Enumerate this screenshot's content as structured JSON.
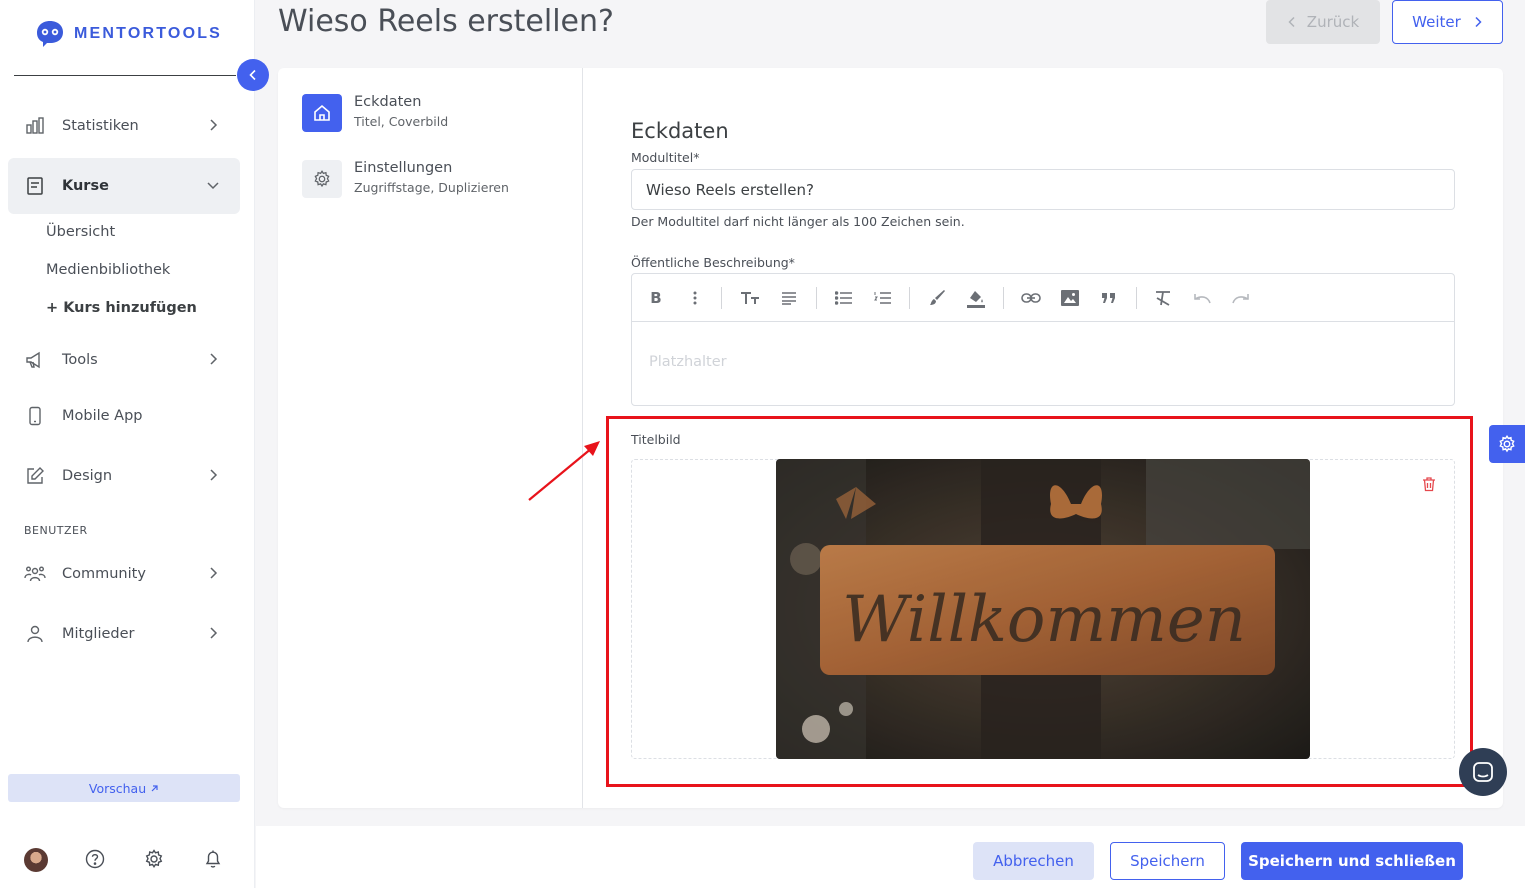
{
  "brand": {
    "name": "MENTORTOOLS"
  },
  "sidebar": {
    "items": [
      {
        "label": "Statistiken",
        "icon": "bar-chart-icon"
      },
      {
        "label": "Kurse",
        "icon": "book-icon"
      },
      {
        "label": "Tools",
        "icon": "megaphone-icon"
      },
      {
        "label": "Mobile App",
        "icon": "smartphone-icon"
      },
      {
        "label": "Design",
        "icon": "edit-icon"
      },
      {
        "label": "Community",
        "icon": "users-icon"
      },
      {
        "label": "Mitglieder",
        "icon": "user-icon"
      }
    ],
    "sub_items": [
      "Übersicht",
      "Medienbibliothek",
      "+ Kurs hinzufügen"
    ],
    "section_label": "BENUTZER",
    "preview_label": "Vorschau"
  },
  "header": {
    "title": "Wieso Reels erstellen?",
    "back_label": "Zurück",
    "next_label": "Weiter"
  },
  "steps": [
    {
      "title": "Eckdaten",
      "subtitle": "Titel, Coverbild"
    },
    {
      "title": "Einstellungen",
      "subtitle": "Zugriffstage, Duplizieren"
    }
  ],
  "form": {
    "section_title": "Eckdaten",
    "module_title_label": "Modultitel*",
    "module_title_value": "Wieso Reels erstellen?",
    "module_title_hint": "Der Modultitel darf nicht länger als 100 Zeichen sein.",
    "description_label": "Öffentliche Beschreibung*",
    "description_placeholder": "Platzhalter",
    "cover_label": "Titelbild"
  },
  "footer": {
    "cancel_label": "Abbrechen",
    "save_label": "Speichern",
    "save_close_label": "Speichern und schließen"
  },
  "colors": {
    "accent": "#4361ee",
    "highlight": "#e8131b"
  }
}
